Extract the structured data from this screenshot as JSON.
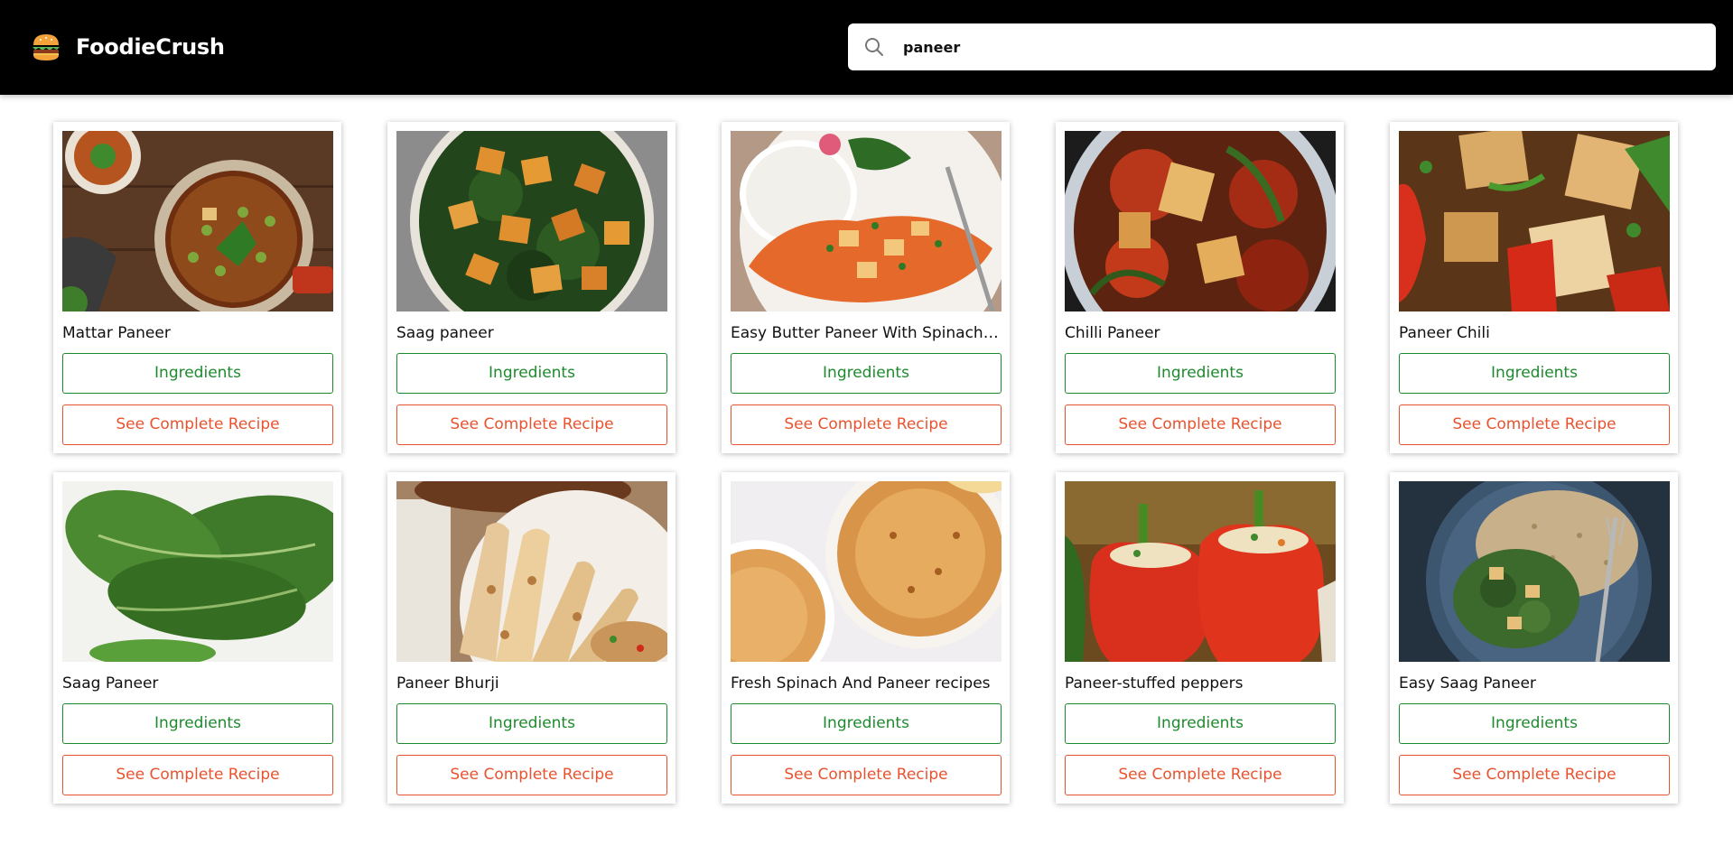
{
  "header": {
    "brand": "FoodieCrush",
    "logo_icon": "burger-icon",
    "search_icon": "search-icon",
    "search_value": "paneer"
  },
  "buttons": {
    "ingredients_label": "Ingredients",
    "recipe_label": "See Complete Recipe"
  },
  "colors": {
    "header_bg": "#000000",
    "ingredients": "#1e8a2e",
    "recipe": "#e8532f"
  },
  "recipes": [
    {
      "title": "Mattar Paneer"
    },
    {
      "title": "Saag paneer"
    },
    {
      "title": "Easy Butter Paneer With Spinach R..."
    },
    {
      "title": "Chilli Paneer"
    },
    {
      "title": "Paneer Chili"
    },
    {
      "title": "Saag Paneer"
    },
    {
      "title": "Paneer Bhurji"
    },
    {
      "title": "Fresh Spinach And Paneer recipes"
    },
    {
      "title": "Paneer-stuffed peppers"
    },
    {
      "title": "Easy Saag Paneer"
    }
  ]
}
